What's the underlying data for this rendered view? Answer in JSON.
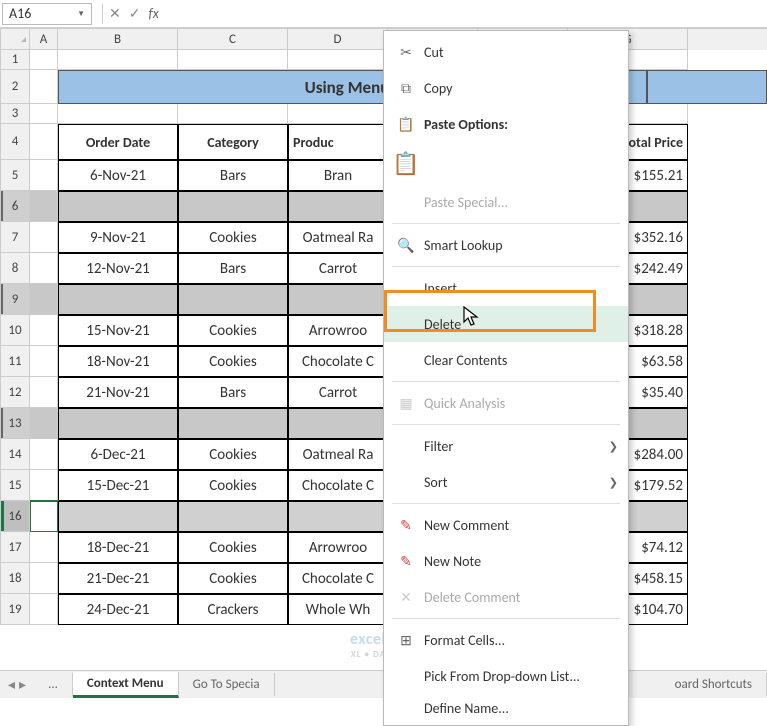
{
  "name_box": "A16",
  "fx_label": "fx",
  "title_banner": "Using Menu L",
  "headers": [
    "Order Date",
    "Category",
    "Produc",
    "",
    "",
    "otal Price"
  ],
  "col_letters": [
    "A",
    "B",
    "C",
    "D",
    "",
    "",
    "G"
  ],
  "row_nums": [
    "1",
    "2",
    "3",
    "4",
    "5",
    "6",
    "7",
    "8",
    "9",
    "10",
    "11",
    "12",
    "13",
    "14",
    "15",
    "16",
    "17",
    "18",
    "19"
  ],
  "data_rows": [
    {
      "r": 5,
      "date": "6-Nov-21",
      "cat": "Bars",
      "prod": "Bran",
      "price": "$155.21",
      "sel": false
    },
    {
      "r": 6,
      "date": "",
      "cat": "",
      "prod": "",
      "price": "",
      "sel": true
    },
    {
      "r": 7,
      "date": "9-Nov-21",
      "cat": "Cookies",
      "prod": "Oatmeal Ra",
      "price": "$352.16",
      "sel": false
    },
    {
      "r": 8,
      "date": "12-Nov-21",
      "cat": "Bars",
      "prod": "Carrot",
      "price": "$242.49",
      "sel": false
    },
    {
      "r": 9,
      "date": "",
      "cat": "",
      "prod": "",
      "price": "",
      "sel": true
    },
    {
      "r": 10,
      "date": "15-Nov-21",
      "cat": "Cookies",
      "prod": "Arrowroo",
      "price": "$318.28",
      "sel": false
    },
    {
      "r": 11,
      "date": "18-Nov-21",
      "cat": "Cookies",
      "prod": "Chocolate C",
      "price": "$63.58",
      "sel": false
    },
    {
      "r": 12,
      "date": "21-Nov-21",
      "cat": "Bars",
      "prod": "Carrot",
      "price": "$35.40",
      "sel": false
    },
    {
      "r": 13,
      "date": "",
      "cat": "",
      "prod": "",
      "price": "",
      "sel": true
    },
    {
      "r": 14,
      "date": "6-Dec-21",
      "cat": "Cookies",
      "prod": "Oatmeal Ra",
      "price": "$284.00",
      "sel": false
    },
    {
      "r": 15,
      "date": "15-Dec-21",
      "cat": "Cookies",
      "prod": "Chocolate C",
      "price": "$179.52",
      "sel": false
    },
    {
      "r": 16,
      "date": "",
      "cat": "",
      "prod": "",
      "price": "",
      "sel": true,
      "active": true
    },
    {
      "r": 17,
      "date": "18-Dec-21",
      "cat": "Cookies",
      "prod": "Arrowroo",
      "price": "$74.12",
      "sel": false
    },
    {
      "r": 18,
      "date": "21-Dec-21",
      "cat": "Cookies",
      "prod": "Chocolate C",
      "price": "$458.15",
      "sel": false
    },
    {
      "r": 19,
      "date": "24-Dec-21",
      "cat": "Crackers",
      "prod": "Whole Wh",
      "price": "$104.70",
      "sel": false
    }
  ],
  "context_menu": {
    "cut": "Cut",
    "copy": "Copy",
    "paste_options": "Paste Options:",
    "paste_special": "Paste Special...",
    "smart_lookup": "Smart Lookup",
    "insert": "Insert",
    "delete": "Delete",
    "clear_contents": "Clear Contents",
    "quick_analysis": "Quick Analysis",
    "filter": "Filter",
    "sort": "Sort",
    "new_comment": "New Comment",
    "new_note": "New Note",
    "delete_comment": "Delete Comment",
    "format_cells": "Format Cells...",
    "pick_list": "Pick From Drop-down List...",
    "define_name": "Define Name..."
  },
  "sheet_tabs": {
    "nav_dots": "...",
    "active": "Context Menu",
    "t2": "Go To Specia",
    "right": "oard Shortcuts"
  },
  "watermark": "exceldem",
  "watermark_sub": "XL • DATA • LI"
}
